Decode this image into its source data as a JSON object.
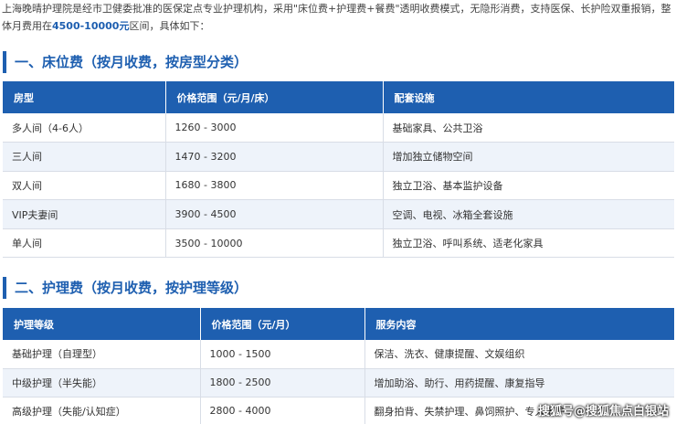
{
  "intro": {
    "text_before": "上海晚晴护理院是经市卫健委批准的医保定点专业护理机构，采用\"床位费+护理费+餐费\"透明收费模式，无隐形消费，支持医保、长护险双重报销，整体月费用在",
    "highlight": "4500-10000元",
    "text_after": "区间，具体如下："
  },
  "section1": {
    "title": "一、床位费（按月收费，按房型分类）",
    "headers": [
      "房型",
      "价格范围（元/月/床）",
      "配套设施"
    ],
    "rows": [
      [
        "多人间（4-6人）",
        "1260 - 3000",
        "基础家具、公共卫浴"
      ],
      [
        "三人间",
        "1470 - 3200",
        "增加独立储物空间"
      ],
      [
        "双人间",
        "1680 - 3800",
        "独立卫浴、基本监护设备"
      ],
      [
        "VIP夫妻间",
        "3900 - 4500",
        "空调、电视、冰箱全套设施"
      ],
      [
        "单人间",
        "3500 - 10000",
        "独立卫浴、呼叫系统、适老化家具"
      ]
    ]
  },
  "section2": {
    "title": "二、护理费（按月收费，按护理等级）",
    "headers": [
      "护理等级",
      "价格范围（元/月）",
      "服务内容"
    ],
    "rows": [
      [
        "基础护理（自理型）",
        "1000 - 1500",
        "保洁、洗衣、健康提醒、文娱组织"
      ],
      [
        "中级护理（半失能）",
        "1800 - 2500",
        "增加助浴、助行、用药提醒、康复指导"
      ],
      [
        "高级护理（失能/认知症）",
        "2800 - 4000",
        "翻身拍背、失禁护理、鼻饲照护、专人陪护"
      ]
    ]
  },
  "watermark": "搜狐号@搜狐焦点白银站"
}
